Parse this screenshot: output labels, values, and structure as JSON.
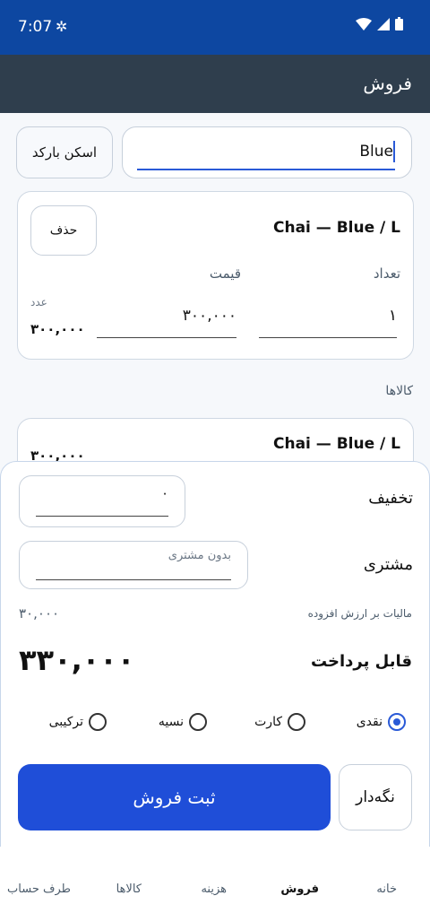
{
  "status": {
    "time": "7:07"
  },
  "appbar": {
    "title": "فروش"
  },
  "scan": {
    "button": "اسکن بارکد",
    "query": "Blue"
  },
  "cart_item": {
    "title": "Chai — Blue / L",
    "delete_label": "حذف",
    "qty_label": "تعداد",
    "price_label": "قیمت",
    "qty_value": "۱",
    "price_value": "۳۰۰,۰۰۰",
    "unit_label": "عدد",
    "line_total": "۳۰۰,۰۰۰"
  },
  "goods": {
    "section_title": "کالاها",
    "item_title": "Chai — Blue / L",
    "item_price": "۳۰۰,۰۰۰"
  },
  "checkout": {
    "discount_label": "تخفیف",
    "discount_value": "۰",
    "customer_label": "مشتری",
    "customer_placeholder": "بدون مشتری",
    "vat_label": "مالیات بر ارزش افزوده",
    "vat_value": "۳۰,۰۰۰",
    "payable_label": "قابل پرداخت",
    "payable_value": "۳۳۰,۰۰۰",
    "methods": [
      "نقدی",
      "کارت",
      "نسیه",
      "ترکیبی"
    ],
    "selected_method": "نقدی",
    "submit_label": "ثبت فروش",
    "hold_label": "نگه‌دار"
  },
  "nav": [
    "خانه",
    "فروش",
    "هزینه",
    "کالاها",
    "طرف حساب"
  ],
  "nav_active": "فروش",
  "colors": {
    "primary": "#1f4ed8",
    "appbar": "#2f3e4d",
    "statusbar": "#0d47a1"
  }
}
